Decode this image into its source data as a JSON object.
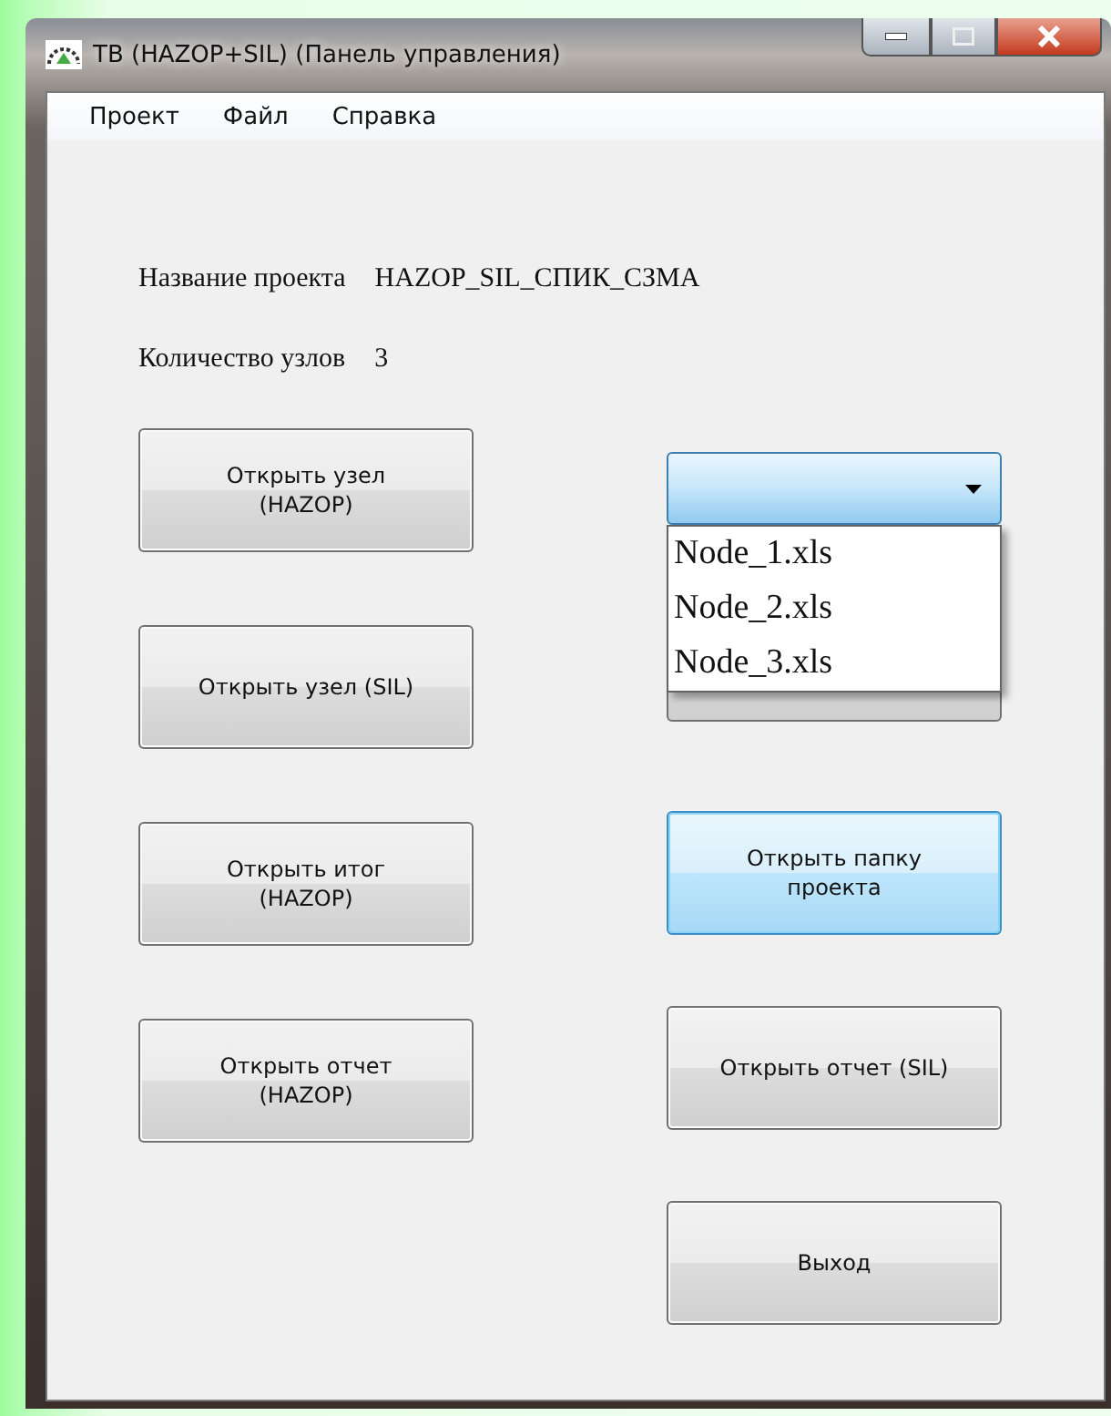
{
  "window": {
    "title": "ТВ (HAZOP+SIL) (Панель управления)"
  },
  "menu": [
    "Проект",
    "Файл",
    "Справка"
  ],
  "fields": [
    {
      "label": "Название проекта",
      "value": "HAZOP_SIL_СПИК_СЗМА"
    },
    {
      "label": "Количество узлов",
      "value": "3"
    }
  ],
  "left_buttons": [
    {
      "label": "Открыть узел\n(HAZOP)",
      "focused": false
    },
    {
      "label": "Открыть узел (SIL)",
      "focused": false
    },
    {
      "label": "Открыть итог\n(HAZOP)",
      "focused": false
    },
    {
      "label": "Открыть отчет\n(HAZOP)",
      "focused": false
    }
  ],
  "node_dropdown": {
    "expanded": true,
    "options": [
      "Node_1.xls",
      "Node_2.xls",
      "Node_3.xls"
    ]
  },
  "right_buttons": [
    {
      "label": "Открыть папку\nпроекта",
      "focused": true
    },
    {
      "label": "Открыть отчет (SIL)",
      "focused": false
    },
    {
      "label": "Выход",
      "focused": false
    }
  ]
}
